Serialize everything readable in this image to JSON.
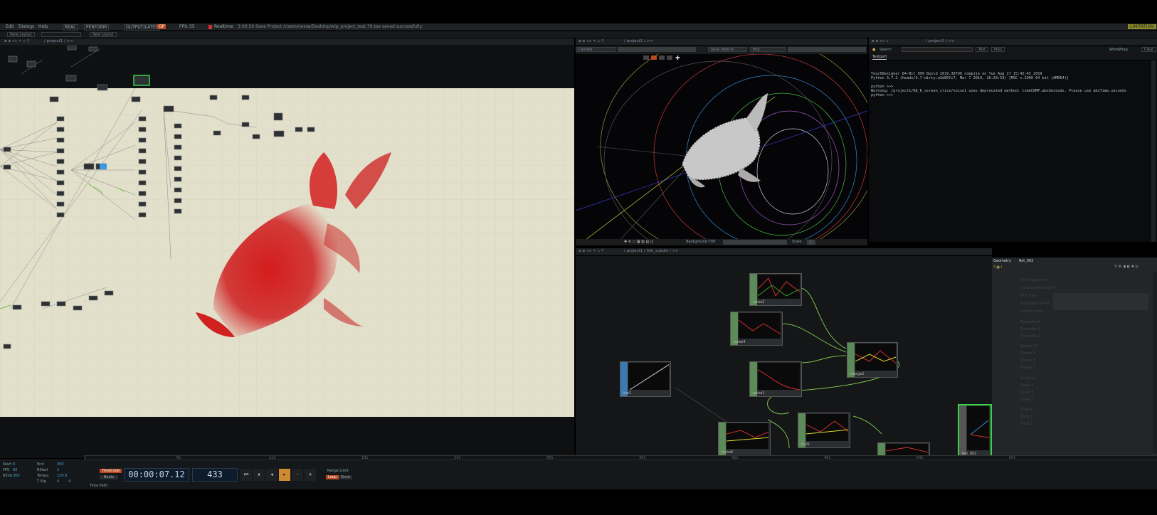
{
  "menubar": {
    "items": [
      "Edit",
      "Dialogs",
      "Help",
      "REAL",
      "PERFORM",
      "OUTPUT/LATES",
      "OP",
      "FPS:",
      "55",
      "Realtime"
    ],
    "status_message": "3:06:56 Save Project /Users/nesse/Desktop/wip_project_test.79.toe saved successfully.",
    "right_badge": "LIMITATION"
  },
  "layoutbar": {
    "pane_layout_label": "Pane Layout",
    "new_layout_label": "New Layout"
  },
  "left_pane": {
    "path": "/ project1 / >>"
  },
  "viewer_pane": {
    "path": "/ project1 / >>",
    "camera_select": "Camera",
    "save_view_label": "Save View to",
    "pick_label": "Pick",
    "background_top_label": "Background TOP",
    "scale_label": "Scale",
    "scale_value": "1"
  },
  "textport": {
    "path": "/ project1 / >>",
    "search_label": "Search",
    "text_btn": "Text",
    "prev_btn": "Prev",
    "wordwrap_label": "WordWrap",
    "clear_btn": "Clear",
    "tab_label": "Textport",
    "lines": [
      "TouchDesigner 64-Bit 099 Build 2019.30790 compile on Tue Aug 27 15:42:45 2019",
      "Python 3.7.2 (heads/3.7-dirty:a3d89fc7, Mar  7 2019, 16:29:53) [MSC v.1900 64 bit (AMD64)]",
      "",
      "python >>>",
      "Warning: /project1/68_K_screen_slice/noise1 uses deprecated method:  timeCOMP.absSeconds. Please use absTime.seconds",
      "python >>>"
    ]
  },
  "network_pane": {
    "path": "/ project1 / fish_subdiv / >>",
    "nodes": [
      {
        "label": "noise2"
      },
      {
        "label": "noise4"
      },
      {
        "label": "merge2"
      },
      {
        "label": "line1"
      },
      {
        "label": "noise1"
      },
      {
        "label": "noise6"
      },
      {
        "label": "null1"
      },
      {
        "label": "Rot_002"
      }
    ]
  },
  "param_pane": {
    "op_type": "Geometry",
    "op_name": "Rot_002",
    "rows": [
      "Xord Xpreserve",
      "Default Preserve RT",
      "Pick Trim",
      "Transform Order",
      "Rotate Order",
      "Translate X",
      "Translate Y",
      "Translate Z",
      "Rotate XY",
      "Rotate X",
      "Rotate Y",
      "Rotate Z",
      "Scale 1x",
      "Scale X",
      "Scale Y",
      "Scale Z",
      "Pivot X",
      "Pivot Y",
      "Pivot Z"
    ]
  },
  "timebar": {
    "stats": [
      "Start",
      "0",
      "End",
      "300",
      "FPS",
      "60",
      "RStart",
      "1",
      "REnd",
      "300",
      "Tempo",
      "120.0",
      "T Sig",
      "4",
      "4"
    ],
    "timecode_label": "TimeCode",
    "beats_label": "Beats",
    "timecode": "00:00:07.12",
    "frame": "433",
    "range_limit_label": "Range Limit",
    "loop_label": "Loop",
    "once_label": "Once",
    "time_path_label": "Time Path:",
    "ruler_ticks": [
      "1",
      "61",
      "121",
      "181",
      "241",
      "301",
      "361",
      "421",
      "481",
      "541",
      "601"
    ]
  }
}
